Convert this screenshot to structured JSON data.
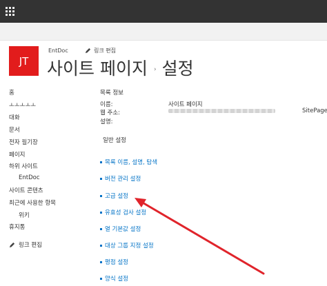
{
  "header": {
    "site_name": "EntDoc",
    "edit_links_label": "링크 편집",
    "breadcrumb_parent": "사이트 페이지",
    "breadcrumb_separator": "›",
    "page_title": "설정",
    "logo_text": "JT",
    "logo_color": "#e21c1c"
  },
  "leftnav": {
    "items": [
      {
        "label": "홈"
      },
      {
        "label": "ㅗㅗㅗㅗㅗ"
      },
      {
        "label": "대화"
      },
      {
        "label": "문서"
      },
      {
        "label": "전자 필기장"
      },
      {
        "label": "페이지"
      },
      {
        "label": "하위 사이트"
      },
      {
        "label": "EntDoc"
      },
      {
        "label": "사이트 콘텐츠"
      },
      {
        "label": "최근에 사용한 항목"
      },
      {
        "label": "위키"
      },
      {
        "label": "휴지통"
      }
    ],
    "edit_links_label": "링크 편집"
  },
  "list_info": {
    "heading": "목록 정보",
    "name_label": "이름:",
    "name_value": "사이트 페이지",
    "url_label": "웹 주소:",
    "url_suffix": "SitePage",
    "description_label": "설명:"
  },
  "general_settings": {
    "heading": "일반 설정",
    "links": [
      {
        "label": "목록 이름, 설명, 탐색"
      },
      {
        "label": "버전 관리 설정"
      },
      {
        "label": "고급 설정"
      },
      {
        "label": "유효성 검사 설정"
      },
      {
        "label": "열 기본값 설정"
      },
      {
        "label": "대상 그룹 지정 설정"
      },
      {
        "label": "평점 설정"
      },
      {
        "label": "양식 설정"
      }
    ]
  },
  "colors": {
    "link_blue": "#0072c6",
    "annotation_arrow": "#e0242b",
    "suite_bar": "#333333"
  }
}
